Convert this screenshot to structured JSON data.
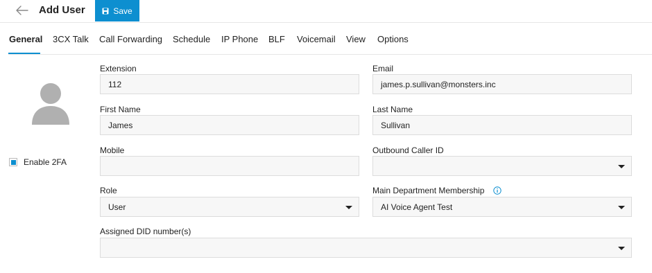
{
  "header": {
    "title": "Add User",
    "save_label": "Save",
    "back_icon": "arrow-left-icon",
    "save_icon": "floppy-disk-icon"
  },
  "tabs": [
    {
      "label": "General",
      "active": true
    },
    {
      "label": "3CX Talk",
      "active": false
    },
    {
      "label": "Call Forwarding",
      "active": false
    },
    {
      "label": "Schedule",
      "active": false
    },
    {
      "label": "IP Phone",
      "active": false
    },
    {
      "label": "BLF",
      "active": false
    },
    {
      "label": "Voicemail",
      "active": false
    },
    {
      "label": "View",
      "active": false
    },
    {
      "label": "Options",
      "active": false
    }
  ],
  "sidebar": {
    "avatar_icon": "user-avatar-icon",
    "enable_2fa_label": "Enable 2FA",
    "enable_2fa_checked": true
  },
  "form": {
    "extension": {
      "label": "Extension",
      "value": "112"
    },
    "email": {
      "label": "Email",
      "value": "james.p.sullivan@monsters.inc"
    },
    "first_name": {
      "label": "First Name",
      "value": "James"
    },
    "last_name": {
      "label": "Last Name",
      "value": "Sullivan"
    },
    "mobile": {
      "label": "Mobile",
      "value": ""
    },
    "outbound_caller_id": {
      "label": "Outbound Caller ID",
      "value": ""
    },
    "role": {
      "label": "Role",
      "value": "User"
    },
    "main_department": {
      "label": "Main Department Membership",
      "value": "AI Voice Agent Test",
      "info_icon": "info-icon"
    },
    "assigned_did": {
      "label": "Assigned DID number(s)",
      "value": ""
    }
  },
  "colors": {
    "accent": "#0d8fd0",
    "field_background": "#f7f7f7",
    "field_border": "#dcdcdc"
  }
}
